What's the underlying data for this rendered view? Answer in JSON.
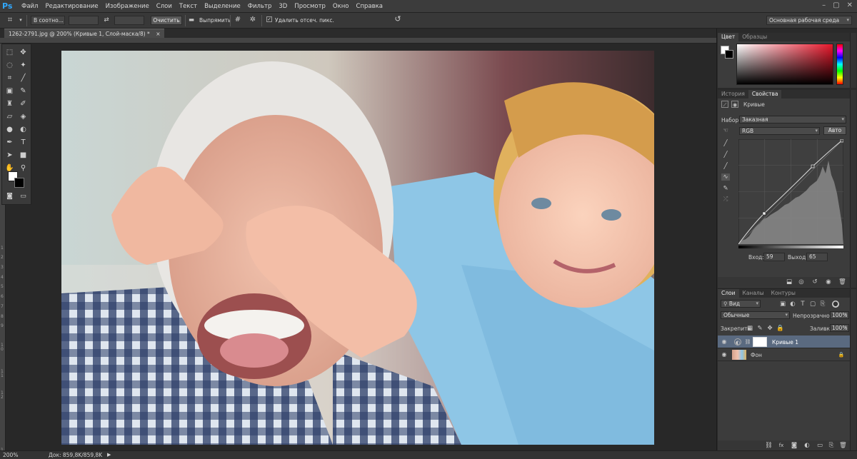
{
  "menubar": {
    "logo": "Ps",
    "items": [
      "Файл",
      "Редактирование",
      "Изображение",
      "Слои",
      "Текст",
      "Выделение",
      "Фильтр",
      "3D",
      "Просмотр",
      "Окно",
      "Справка"
    ],
    "controls": [
      "–",
      "▢",
      "✕"
    ]
  },
  "options": {
    "ratio_label": "В соотно...",
    "clear_label": "Очистить",
    "straighten_label": "Выпрямить",
    "delete_cropped_label": "Удалить отсеч. пикс.",
    "delete_cropped_checked": true,
    "workspace_label": "Основная рабочая среда"
  },
  "document": {
    "tab_title": "1262-2791.jpg @ 200% (Кривые 1, Слой-маска/8) *",
    "close_glyph": "×"
  },
  "ruler": {
    "left_ticks": [
      "1",
      "2",
      "3",
      "4",
      "5",
      "6",
      "7",
      "8",
      "9",
      "1 0",
      "1 1",
      "1 2",
      "1 3"
    ]
  },
  "status": {
    "zoom": "200%",
    "doc_info": "Док: 859,8K/859,8K"
  },
  "color_panel": {
    "tabs": [
      "Цвет",
      "Образцы"
    ],
    "fg_color": "#ffffff",
    "bg_color": "#000000",
    "hue_color": "#e8162a"
  },
  "properties_panel": {
    "tabs": [
      "История",
      "Свойства"
    ],
    "title": "Кривые",
    "preset_label": "Набор:",
    "preset_value": "Заказная",
    "channel_value": "RGB",
    "auto_label": "Авто",
    "input_label": "Вход:",
    "input_value": "59",
    "output_label": "Выход:",
    "output_value": "65"
  },
  "layers_panel": {
    "tabs": [
      "Слои",
      "Каналы",
      "Контуры"
    ],
    "filter_label": "Вид",
    "blend_mode": "Обычные",
    "opacity_label": "Непрозрачность:",
    "opacity_value": "100%",
    "lock_label": "Закрепить:",
    "fill_label": "Заливка:",
    "fill_value": "100%",
    "layers": [
      {
        "name": "Кривые 1",
        "selected": true
      },
      {
        "name": "Фон",
        "selected": false
      }
    ]
  },
  "colors": {
    "accent": "#31a8ff",
    "selected_layer": "#5a6a80"
  }
}
